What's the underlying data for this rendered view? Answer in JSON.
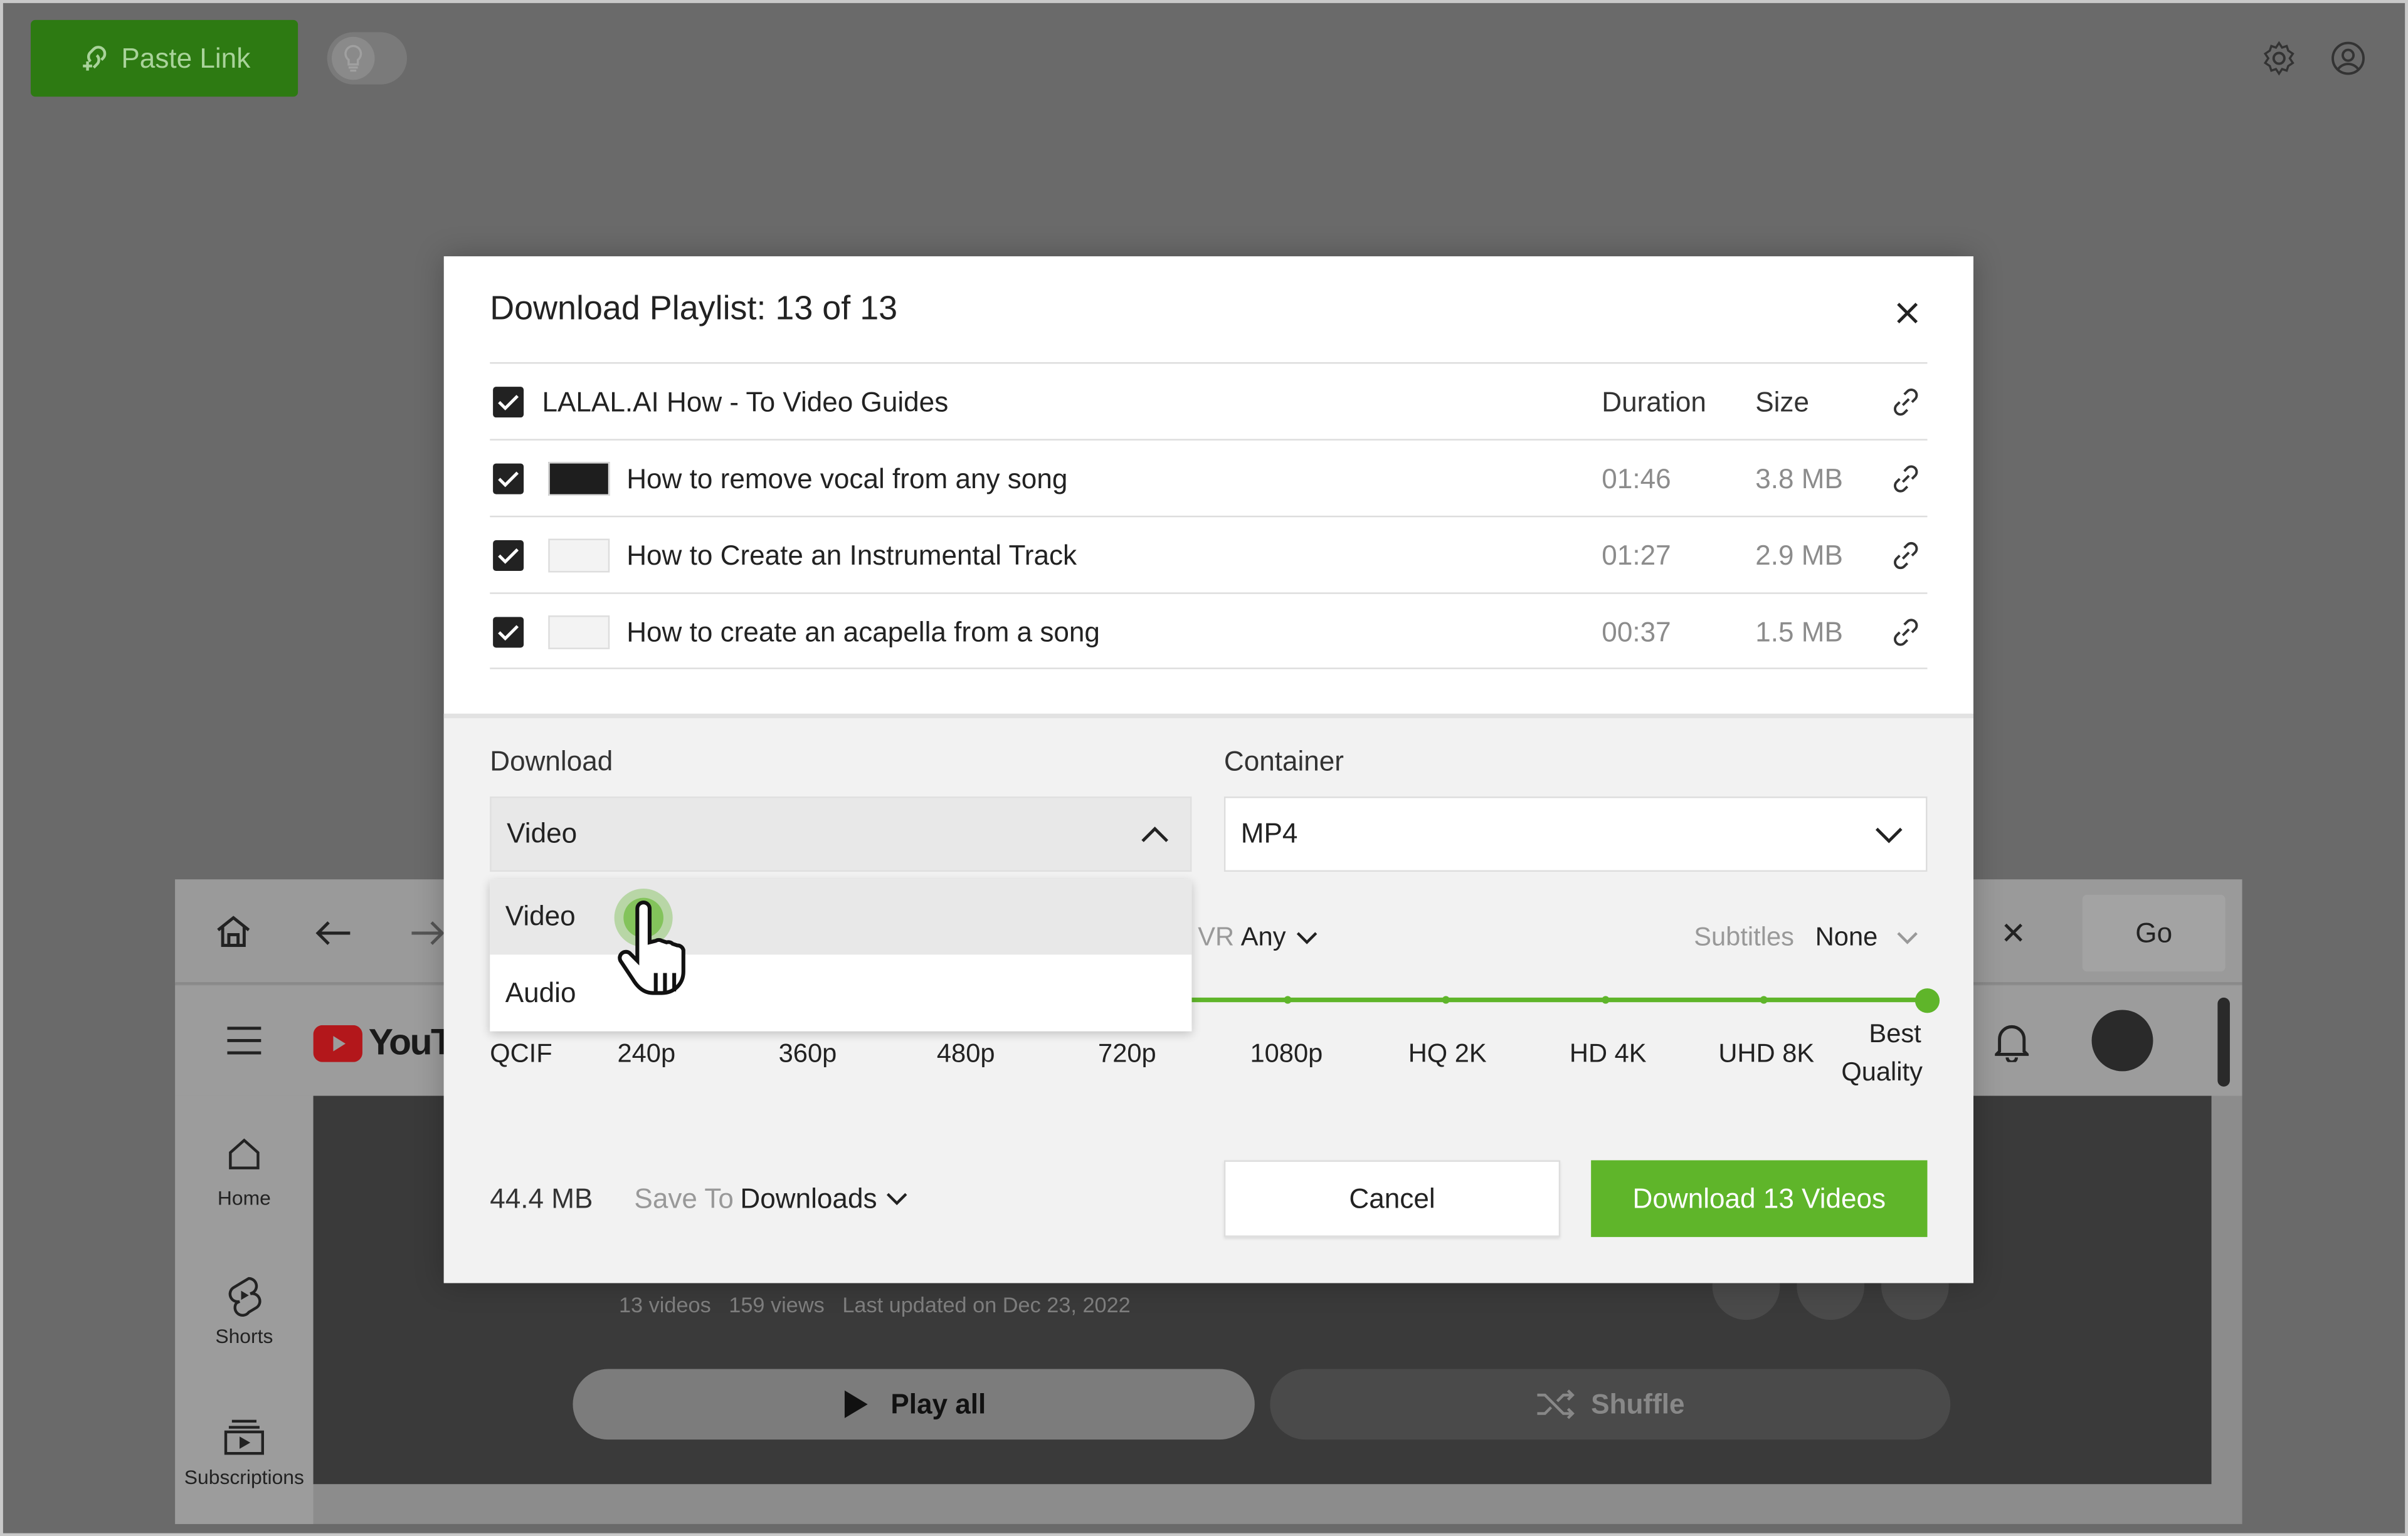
{
  "topbar": {
    "paste_link_label": "Paste Link"
  },
  "background_browser": {
    "close_label": "✕",
    "go_label": "Go",
    "yt_logo_text": "YouTu",
    "sidebar": [
      {
        "label": "Home",
        "icon": "home-icon"
      },
      {
        "label": "Shorts",
        "icon": "shorts-icon"
      },
      {
        "label": "Subscriptions",
        "icon": "subscriptions-icon"
      }
    ],
    "playlist_meta": "13 videos   159 views   Last updated on Dec 23, 2022",
    "play_all_label": "Play all",
    "shuffle_label": "Shuffle"
  },
  "modal": {
    "title": "Download Playlist: 13 of 13",
    "header": {
      "playlist_name": "LALAL.AI How - To Video Guides",
      "duration_header": "Duration",
      "size_header": "Size"
    },
    "rows": [
      {
        "title": "How to remove vocal from any song",
        "duration": "01:46",
        "size": "3.8 MB",
        "checked": true
      },
      {
        "title": "How to Create an Instrumental Track",
        "duration": "01:27",
        "size": "2.9 MB",
        "checked": true
      },
      {
        "title": "How to create an acapella from a song",
        "duration": "00:37",
        "size": "1.5 MB",
        "checked": true
      }
    ],
    "download_label": "Download",
    "download_value": "Video",
    "download_options": [
      "Video",
      "Audio"
    ],
    "container_label": "Container",
    "container_value": "MP4",
    "vr_label": "VR",
    "vr_value": "Any",
    "subtitles_label": "Subtitles",
    "subtitles_value": "None",
    "quality_levels": [
      "QCIF",
      "240p",
      "360p",
      "480p",
      "720p",
      "1080p",
      "HQ 2K",
      "HD 4K",
      "UHD 8K",
      "Best Quality"
    ],
    "quality_best_line1": "Best",
    "quality_best_line2": "Quality",
    "total_size": "44.4 MB",
    "save_to_label": "Save To",
    "save_to_value": "Downloads",
    "cancel_label": "Cancel",
    "download_button_label": "Download 13 Videos"
  },
  "colors": {
    "accent": "#5fb52a",
    "paste_button": "#2d7a12",
    "overlay": "#6a6a6a"
  }
}
